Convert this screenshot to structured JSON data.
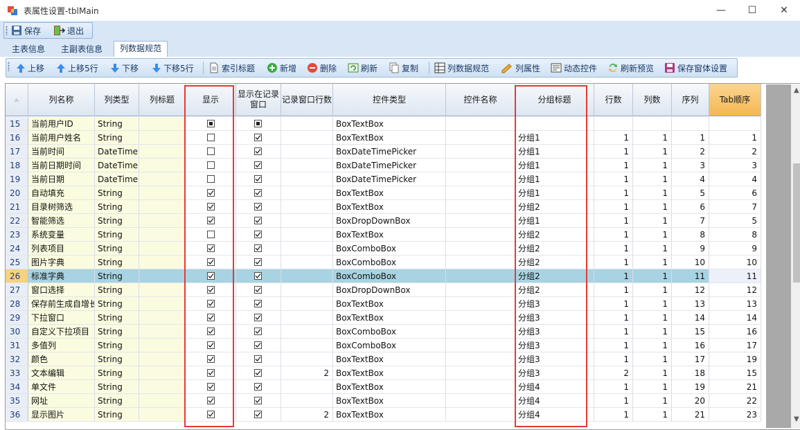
{
  "window": {
    "title": "表属性设置-tblMain",
    "min": "—",
    "max": "☐",
    "close": "✕"
  },
  "toolbar1": {
    "save": "保存",
    "exit": "退出"
  },
  "tabs": [
    "主表信息",
    "主副表信息",
    "列数据规范"
  ],
  "toolbar2": {
    "up": "上移",
    "up5": "上移5行",
    "down": "下移",
    "down5": "下移5行",
    "index_title": "索引标题",
    "add": "新增",
    "delete": "删除",
    "refresh": "刷新",
    "copy": "复制",
    "col_spec": "列数据规范",
    "col_prop": "列属性",
    "dyn_ctrl": "动态控件",
    "refresh_preview": "刷新预览",
    "save_form": "保存窗体设置"
  },
  "columns": [
    "列名称",
    "列类型",
    "列标题",
    "显示",
    "显示在记录窗口",
    "记录窗口行数",
    "控件类型",
    "控件名称",
    "分组标题",
    "行数",
    "列数",
    "序列",
    "Tab顺序"
  ],
  "selected_row": 26,
  "rows": [
    {
      "n": "15",
      "name": "当前用户ID",
      "type": "String",
      "show": "ind",
      "rec": "ind",
      "recrows": "",
      "ctrl": "BoxTextBox",
      "group": "",
      "r": "",
      "c": "",
      "seq": "",
      "tab": ""
    },
    {
      "n": "16",
      "name": "当前用户姓名",
      "type": "String",
      "show": "off",
      "rec": "on",
      "recrows": "",
      "ctrl": "BoxTextBox",
      "group": "分组1",
      "r": "1",
      "c": "1",
      "seq": "1",
      "tab": "1"
    },
    {
      "n": "17",
      "name": "当前时间",
      "type": "DateTime",
      "show": "off",
      "rec": "on",
      "recrows": "",
      "ctrl": "BoxDateTimePicker",
      "group": "分组1",
      "r": "1",
      "c": "1",
      "seq": "2",
      "tab": "2"
    },
    {
      "n": "18",
      "name": "当前日期时间",
      "type": "DateTime",
      "show": "off",
      "rec": "on",
      "recrows": "",
      "ctrl": "BoxDateTimePicker",
      "group": "分组1",
      "r": "1",
      "c": "1",
      "seq": "3",
      "tab": "3"
    },
    {
      "n": "19",
      "name": "当前日期",
      "type": "DateTime",
      "show": "off",
      "rec": "on",
      "recrows": "",
      "ctrl": "BoxDateTimePicker",
      "group": "分组1",
      "r": "1",
      "c": "1",
      "seq": "4",
      "tab": "4"
    },
    {
      "n": "20",
      "name": "自动填充",
      "type": "String",
      "show": "on",
      "rec": "on",
      "recrows": "",
      "ctrl": "BoxTextBox",
      "group": "分组1",
      "r": "1",
      "c": "1",
      "seq": "5",
      "tab": "6"
    },
    {
      "n": "21",
      "name": "目录树筛选",
      "type": "String",
      "show": "on",
      "rec": "on",
      "recrows": "",
      "ctrl": "BoxTextBox",
      "group": "分组2",
      "r": "1",
      "c": "1",
      "seq": "6",
      "tab": "7"
    },
    {
      "n": "22",
      "name": "智能筛选",
      "type": "String",
      "show": "on",
      "rec": "on",
      "recrows": "",
      "ctrl": "BoxDropDownBox",
      "group": "分组1",
      "r": "1",
      "c": "1",
      "seq": "7",
      "tab": "5"
    },
    {
      "n": "23",
      "name": "系统变量",
      "type": "String",
      "show": "off",
      "rec": "on",
      "recrows": "",
      "ctrl": "BoxTextBox",
      "group": "分组2",
      "r": "1",
      "c": "1",
      "seq": "8",
      "tab": "8"
    },
    {
      "n": "24",
      "name": "列表项目",
      "type": "String",
      "show": "on",
      "rec": "on",
      "recrows": "",
      "ctrl": "BoxComboBox",
      "group": "分组2",
      "r": "1",
      "c": "1",
      "seq": "9",
      "tab": "9"
    },
    {
      "n": "25",
      "name": "图片字典",
      "type": "String",
      "show": "on",
      "rec": "on",
      "recrows": "",
      "ctrl": "BoxComboBox",
      "group": "分组2",
      "r": "1",
      "c": "1",
      "seq": "10",
      "tab": "10"
    },
    {
      "n": "26",
      "name": "标准字典",
      "type": "String",
      "show": "on",
      "rec": "on",
      "recrows": "",
      "ctrl": "BoxComboBox",
      "group": "分组2",
      "r": "1",
      "c": "1",
      "seq": "11",
      "tab": "11"
    },
    {
      "n": "27",
      "name": "窗口选择",
      "type": "String",
      "show": "on",
      "rec": "on",
      "recrows": "",
      "ctrl": "BoxDropDownBox",
      "group": "分组2",
      "r": "1",
      "c": "1",
      "seq": "12",
      "tab": "12"
    },
    {
      "n": "28",
      "name": "保存前生成自增长",
      "type": "String",
      "show": "on",
      "rec": "on",
      "recrows": "",
      "ctrl": "BoxTextBox",
      "group": "分组3",
      "r": "1",
      "c": "1",
      "seq": "13",
      "tab": "13"
    },
    {
      "n": "29",
      "name": "下拉窗口",
      "type": "String",
      "show": "on",
      "rec": "on",
      "recrows": "",
      "ctrl": "BoxTextBox",
      "group": "分组3",
      "r": "1",
      "c": "1",
      "seq": "14",
      "tab": "14"
    },
    {
      "n": "30",
      "name": "自定义下拉项目",
      "type": "String",
      "show": "on",
      "rec": "on",
      "recrows": "",
      "ctrl": "BoxComboBox",
      "group": "分组3",
      "r": "1",
      "c": "1",
      "seq": "15",
      "tab": "16"
    },
    {
      "n": "31",
      "name": "多值列",
      "type": "String",
      "show": "on",
      "rec": "on",
      "recrows": "",
      "ctrl": "BoxComboBox",
      "group": "分组3",
      "r": "1",
      "c": "1",
      "seq": "16",
      "tab": "17"
    },
    {
      "n": "32",
      "name": "颜色",
      "type": "String",
      "show": "on",
      "rec": "on",
      "recrows": "",
      "ctrl": "BoxTextBox",
      "group": "分组3",
      "r": "1",
      "c": "1",
      "seq": "17",
      "tab": "19"
    },
    {
      "n": "33",
      "name": "文本编辑",
      "type": "String",
      "show": "on",
      "rec": "on",
      "recrows": "2",
      "ctrl": "BoxTextBox",
      "group": "分组3",
      "r": "2",
      "c": "1",
      "seq": "18",
      "tab": "15"
    },
    {
      "n": "34",
      "name": "单文件",
      "type": "String",
      "show": "on",
      "rec": "on",
      "recrows": "",
      "ctrl": "BoxTextBox",
      "group": "分组4",
      "r": "1",
      "c": "1",
      "seq": "19",
      "tab": "21"
    },
    {
      "n": "35",
      "name": "网址",
      "type": "String",
      "show": "on",
      "rec": "on",
      "recrows": "",
      "ctrl": "BoxTextBox",
      "group": "分组4",
      "r": "1",
      "c": "1",
      "seq": "20",
      "tab": "22"
    },
    {
      "n": "36",
      "name": "显示图片",
      "type": "String",
      "show": "on",
      "rec": "on",
      "recrows": "2",
      "ctrl": "BoxTextBox",
      "group": "分组4",
      "r": "1",
      "c": "1",
      "seq": "21",
      "tab": "23"
    }
  ]
}
